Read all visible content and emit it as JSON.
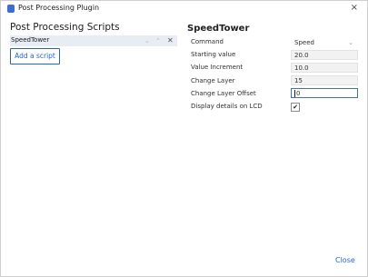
{
  "window": {
    "title": "Post Processing Plugin",
    "close_glyph": "×"
  },
  "left_panel": {
    "heading": "Post Processing Scripts",
    "scripts": [
      {
        "name": "SpeedTower",
        "selected": true
      }
    ],
    "row_controls": {
      "move_down": "⌄",
      "move_up": "⌃",
      "remove": "✕"
    },
    "add_button_label": "Add a script"
  },
  "right_panel": {
    "heading": "SpeedTower",
    "settings": [
      {
        "label": "Command",
        "value": "Speed",
        "type": "select"
      },
      {
        "label": "Starting value",
        "value": "20.0",
        "type": "text"
      },
      {
        "label": "Value Increment",
        "value": "10.0",
        "type": "text"
      },
      {
        "label": "Change Layer",
        "value": "15",
        "type": "text"
      },
      {
        "label": "Change Layer Offset",
        "value": "0",
        "type": "text",
        "focused": true
      },
      {
        "label": "Display details on LCD",
        "checked": true,
        "type": "checkbox"
      }
    ],
    "select_chevron": "⌄",
    "check_glyph": "✔"
  },
  "footer": {
    "close_label": "Close"
  },
  "colors": {
    "accent": "#2a64c5",
    "selection": "#e7ecf5"
  }
}
